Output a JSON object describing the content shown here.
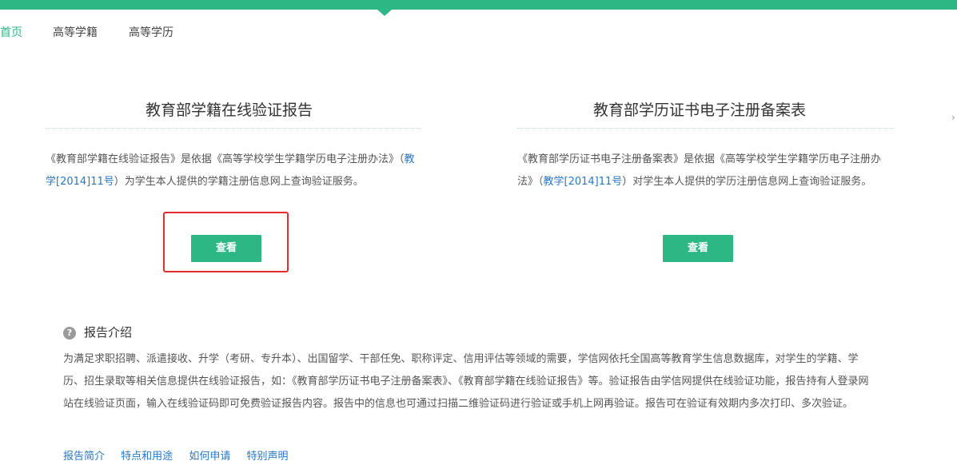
{
  "nav": {
    "home": "首页",
    "items": [
      "高等学籍",
      "高等学历"
    ]
  },
  "panels": [
    {
      "title": "教育部学籍在线验证报告",
      "desc_before": "《教育部学籍在线验证报告》是依据《高等学校学生学籍学历电子注册办法》（",
      "desc_link": "教学[2014]11号",
      "desc_after": "）为学生本人提供的学籍注册信息网上查询验证服务。",
      "button": "查看"
    },
    {
      "title": "教育部学历证书电子注册备案表",
      "desc_before": "《教育部学历证书电子注册备案表》是依据《高等学校学生学籍学历电子注册办法》（",
      "desc_link": "教学[2014]11号",
      "desc_after": "）对学生本人提供的学历注册信息网上查询验证服务。",
      "button": "查看"
    }
  ],
  "intro": {
    "heading": "报告介绍",
    "body": "为满足求职招聘、派遣接收、升学（考研、专升本）、出国留学、干部任免、职称评定、信用评估等领域的需要，学信网依托全国高等教育学生信息数据库，对学生的学籍、学历、招生录取等相关信息提供在线验证报告，如：《教育部学历证书电子注册备案表》、《教育部学籍在线验证报告》等。验证报告由学信网提供在线验证功能，报告持有人登录网站在线验证页面，输入在线验证码即可免费验证报告内容。报告中的信息也可通过扫描二维验证码进行验证或手机上网再验证。报告可在验证有效期内多次打印、多次验证。",
    "links": [
      "报告简介",
      "特点和用途",
      "如何申请",
      "特别声明"
    ]
  },
  "colors": {
    "brand_green": "#2db784",
    "link_blue": "#2a78c2",
    "highlight_red": "#e52b2b"
  },
  "icons": {
    "help": "question-circle-icon"
  }
}
